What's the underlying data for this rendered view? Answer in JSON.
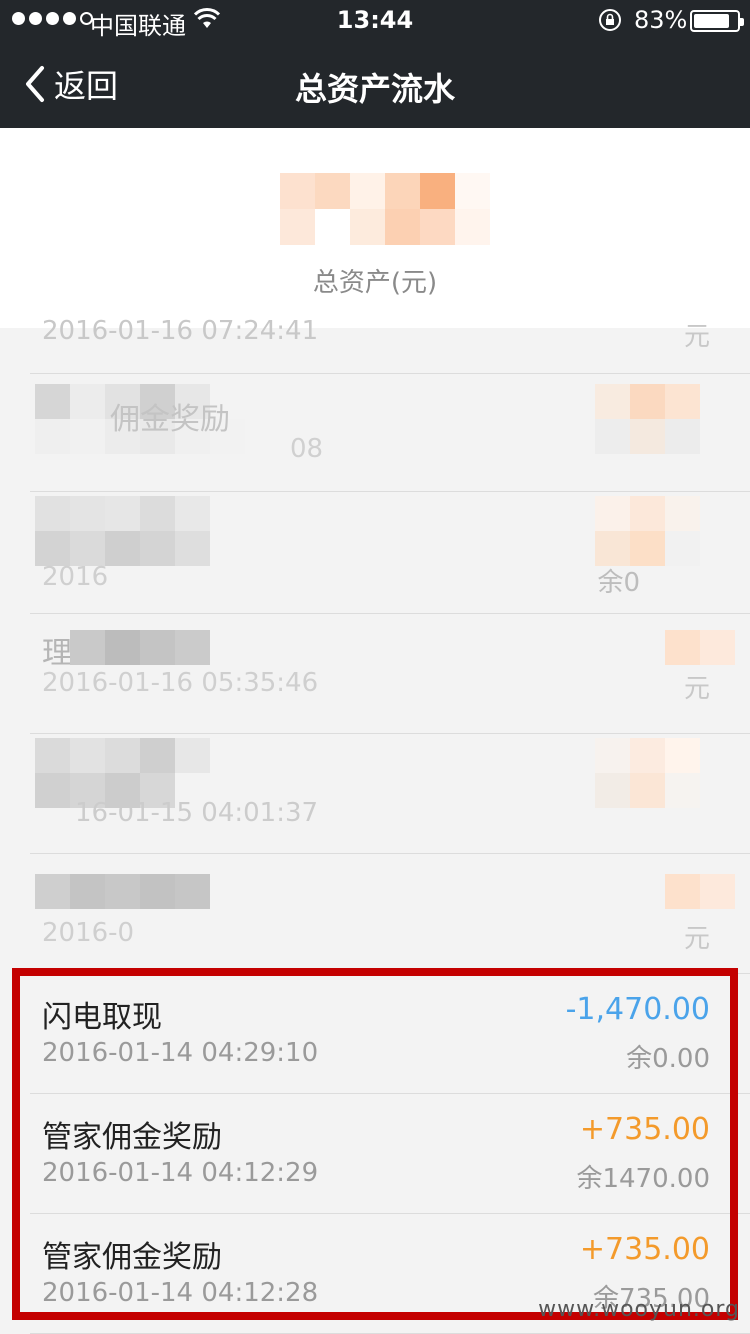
{
  "status": {
    "carrier": "中国联通",
    "time": "13:44",
    "battery": "83%",
    "battery_level": 0.83
  },
  "nav": {
    "back_label": "返回",
    "title": "总资产流水"
  },
  "summary": {
    "label": "总资产(元)"
  },
  "partial_rows": [
    {
      "title": "",
      "date": "2016-01-16 07:24:41",
      "balance": "元"
    },
    {
      "title": "佣金奖励",
      "date": "08",
      "balance": ""
    },
    {
      "title": "",
      "date": "2016",
      "balance": "余0"
    },
    {
      "title": "理",
      "date": "2016-01-16 05:35:46",
      "balance": "元"
    },
    {
      "title": "",
      "date": "16-01-15 04:01:37",
      "balance": ""
    },
    {
      "title": "",
      "date": "2016-0",
      "balance": "元"
    }
  ],
  "transactions": [
    {
      "title": "闪电取现",
      "date": "2016-01-14 04:29:10",
      "amount": "-1,470.00",
      "balance": "余0.00",
      "kind": "neg"
    },
    {
      "title": "管家佣金奖励",
      "date": "2016-01-14 04:12:29",
      "amount": "+735.00",
      "balance": "余1470.00",
      "kind": "pos"
    },
    {
      "title": "管家佣金奖励",
      "date": "2016-01-14 04:12:28",
      "amount": "+735.00",
      "balance": "余735.00",
      "kind": "pos"
    }
  ],
  "watermark": "www.wooyun.org"
}
